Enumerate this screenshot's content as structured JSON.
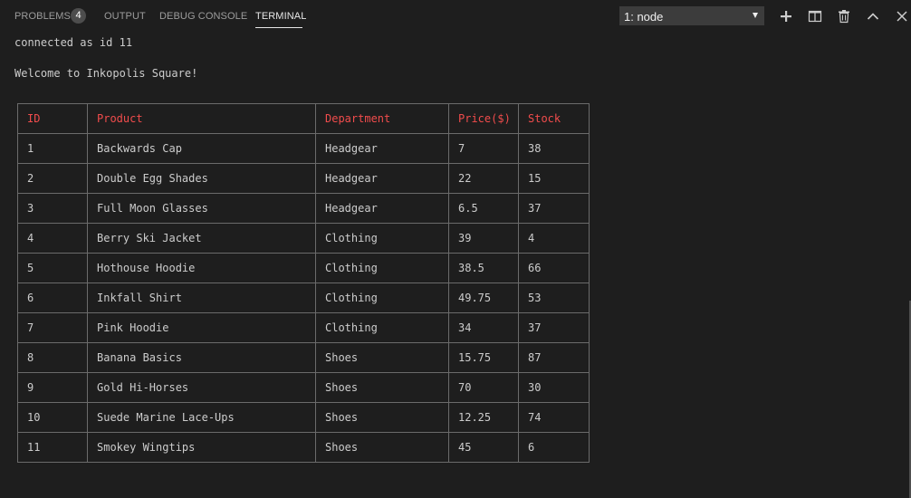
{
  "panel": {
    "tabs": [
      {
        "label": "PROBLEMS"
      },
      {
        "label": "OUTPUT"
      },
      {
        "label": "DEBUG CONSOLE"
      },
      {
        "label": "TERMINAL"
      }
    ],
    "problems_count": "4",
    "active_tab": "TERMINAL",
    "terminal_selector": {
      "value": "1: node"
    },
    "toolbar_icons": [
      "plus-icon",
      "split-terminal-icon",
      "trash-icon",
      "chevron-up-icon",
      "close-icon"
    ]
  },
  "terminal": {
    "lines": [
      "connected as id 11",
      "Welcome to Inkopolis Square!"
    ],
    "table": {
      "headers": [
        "ID",
        "Product",
        "Department",
        "Price($)",
        "Stock"
      ],
      "rows": [
        [
          "1",
          "Backwards Cap",
          "Headgear",
          "7",
          "38"
        ],
        [
          "2",
          "Double Egg Shades",
          "Headgear",
          "22",
          "15"
        ],
        [
          "3",
          "Full Moon Glasses",
          "Headgear",
          "6.5",
          "37"
        ],
        [
          "4",
          "Berry Ski Jacket",
          "Clothing",
          "39",
          "4"
        ],
        [
          "5",
          "Hothouse Hoodie",
          "Clothing",
          "38.5",
          "66"
        ],
        [
          "6",
          "Inkfall Shirt",
          "Clothing",
          "49.75",
          "53"
        ],
        [
          "7",
          "Pink Hoodie",
          "Clothing",
          "34",
          "37"
        ],
        [
          "8",
          "Banana Basics",
          "Shoes",
          "15.75",
          "87"
        ],
        [
          "9",
          "Gold Hi-Horses",
          "Shoes",
          "70",
          "30"
        ],
        [
          "10",
          "Suede Marine Lace-Ups",
          "Shoes",
          "12.25",
          "74"
        ],
        [
          "11",
          "Smokey Wingtips",
          "Shoes",
          "45",
          "6"
        ]
      ]
    }
  },
  "colors": {
    "background": "#1e1e1e",
    "text": "#cccccc",
    "header_text": "#f14c4c",
    "table_border": "#6b6b6b"
  }
}
